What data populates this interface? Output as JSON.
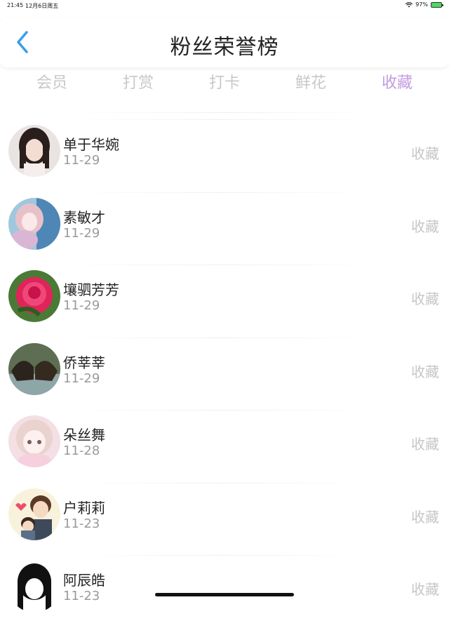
{
  "status_bar": {
    "time": "21:45",
    "date": "12月6日周五",
    "battery": "97%"
  },
  "nav": {
    "title": "粉丝荣誉榜"
  },
  "tabs": [
    {
      "label": "会员",
      "active": false
    },
    {
      "label": "打赏",
      "active": false
    },
    {
      "label": "打卡",
      "active": false
    },
    {
      "label": "鲜花",
      "active": false
    },
    {
      "label": "收藏",
      "active": true
    }
  ],
  "colors": {
    "active_tab": "#c29be0",
    "back_arrow": "#3a9ee8"
  },
  "fans": [
    {
      "name": "单于华婉",
      "date": "11-29",
      "type": "收藏",
      "avatar": "girl-photo-icon"
    },
    {
      "name": "素敏才",
      "date": "11-29",
      "type": "收藏",
      "avatar": "anime-girl-icon"
    },
    {
      "name": "壤驷芳芳",
      "date": "11-29",
      "type": "收藏",
      "avatar": "rose-icon"
    },
    {
      "name": "侨莘莘",
      "date": "11-29",
      "type": "收藏",
      "avatar": "sea-lions-icon"
    },
    {
      "name": "朵丝舞",
      "date": "11-28",
      "type": "收藏",
      "avatar": "pastel-girl-icon"
    },
    {
      "name": "户莉莉",
      "date": "11-23",
      "type": "收藏",
      "avatar": "cartoon-couple-icon"
    },
    {
      "name": "阿辰皓",
      "date": "11-23",
      "type": "收藏",
      "avatar": "bw-girl-icon"
    }
  ]
}
